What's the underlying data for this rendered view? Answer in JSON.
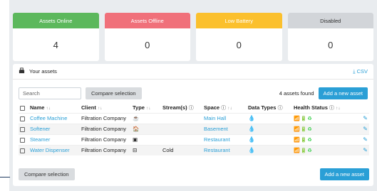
{
  "stats": [
    {
      "label": "Assets Online",
      "value": "4",
      "color": "#5cb85c"
    },
    {
      "label": "Assets Offline",
      "value": "0",
      "color": "#f0707a"
    },
    {
      "label": "Low Battery",
      "value": "0",
      "color": "#fbc02d"
    },
    {
      "label": "Disabled",
      "value": "0",
      "color": "#d2d5d9"
    }
  ],
  "assets": {
    "title": "Your assets",
    "csv_label": "CSV",
    "search_placeholder": "Search",
    "compare_label": "Compare selection",
    "found_label": "4 assets found",
    "add_label": "Add a new asset",
    "columns": {
      "name": "Name",
      "client": "Client",
      "type": "Type",
      "streams": "Stream(s)",
      "space": "Space",
      "data_types": "Data Types",
      "health": "Health Status"
    },
    "rows": [
      {
        "name": "Coffee Machine",
        "client": "Filtration Company",
        "type_icon": "coffee-icon",
        "type_glyph": "☕",
        "stream": "",
        "space": "Main Hall"
      },
      {
        "name": "Softener",
        "client": "Filtration Company",
        "type_icon": "home-icon",
        "type_glyph": "🏠",
        "stream": "",
        "space": "Basement"
      },
      {
        "name": "Steamer",
        "client": "Filtration Company",
        "type_icon": "steamer-icon",
        "type_glyph": "▣",
        "stream": "",
        "space": "Restaurant"
      },
      {
        "name": "Water Dispenser",
        "client": "Filtration Company",
        "type_icon": "dispenser-icon",
        "type_glyph": "⊟",
        "stream": "Cold",
        "space": "Restaurant"
      }
    ]
  },
  "footer": {
    "compare_label": "Compare selection",
    "add_label": "Add a new asset"
  }
}
